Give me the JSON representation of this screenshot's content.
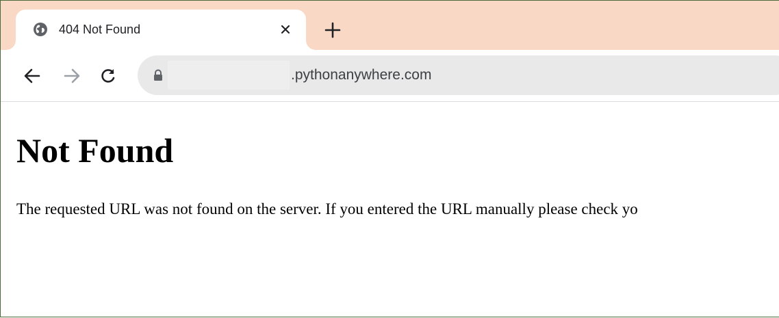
{
  "tab": {
    "title": "404 Not Found",
    "favicon_icon": "globe-icon",
    "close_icon": "close-icon"
  },
  "new_tab_icon": "plus-icon",
  "toolbar": {
    "back_icon": "arrow-left-icon",
    "forward_icon": "arrow-right-icon",
    "reload_icon": "reload-icon",
    "lock_icon": "lock-icon",
    "address_text": ".pythonanywhere.com"
  },
  "page": {
    "heading": "Not Found",
    "message": "The requested URL was not found on the server. If you entered the URL manually please check yo"
  },
  "colors": {
    "tabstrip_bg": "#f9d9c5",
    "omnibox_bg": "#e9e9e9",
    "frame_border": "#4a6a3a"
  }
}
